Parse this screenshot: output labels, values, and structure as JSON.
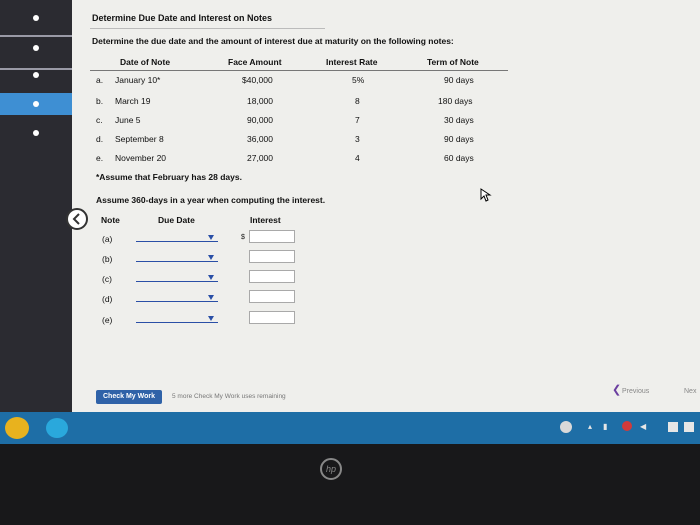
{
  "title": "Determine Due Date and Interest on Notes",
  "instruction": "Determine the due date and the amount of interest due at maturity on the following notes:",
  "table": {
    "headers": [
      "Date of Note",
      "Face Amount",
      "Interest Rate",
      "Term of Note"
    ],
    "rows": [
      {
        "letter": "a.",
        "date": "January 10*",
        "amount": "$40,000",
        "rate": "5%",
        "term": "90 days"
      },
      {
        "letter": "b.",
        "date": "March 19",
        "amount": "18,000",
        "rate": "8",
        "term": "180 days"
      },
      {
        "letter": "c.",
        "date": "June 5",
        "amount": "90,000",
        "rate": "7",
        "term": "30 days"
      },
      {
        "letter": "d.",
        "date": "September 8",
        "amount": "36,000",
        "rate": "3",
        "term": "90 days"
      },
      {
        "letter": "e.",
        "date": "November 20",
        "amount": "27,000",
        "rate": "4",
        "term": "60 days"
      }
    ]
  },
  "footnote": "*Assume that February has 28 days.",
  "assumption": "Assume 360-days in a year when computing the interest.",
  "answer": {
    "headers": [
      "Note",
      "Due Date",
      "Interest"
    ],
    "rows": [
      "(a)",
      "(b)",
      "(c)",
      "(d)",
      "(e)"
    ],
    "currency": "$"
  },
  "check_button": "Check My Work",
  "remaining": "5 more Check My Work uses remaining",
  "previous": "Previous",
  "next": "Nex",
  "logo": "hp",
  "colors": {
    "accent": "#2f62a8",
    "taskbar": "#1e6ea6",
    "nav_active": "#3e8fd3"
  }
}
